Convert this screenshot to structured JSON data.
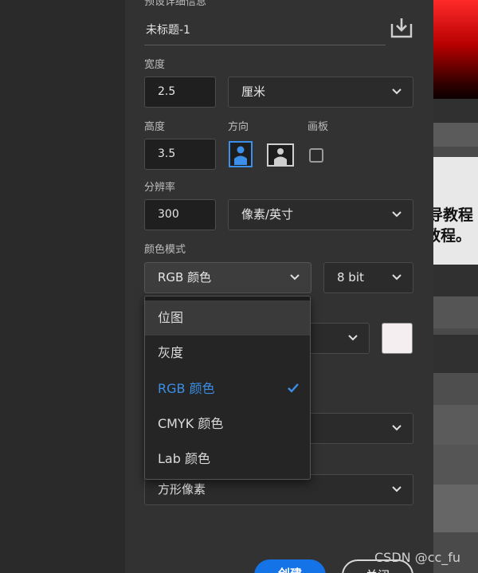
{
  "preset": {
    "title_partial": "预设详细信息",
    "doc_name": "未标题-1"
  },
  "width": {
    "label": "宽度",
    "value": "2.5",
    "unit": "厘米"
  },
  "height": {
    "label": "高度",
    "value": "3.5"
  },
  "orientation": {
    "label": "方向"
  },
  "artboard": {
    "label": "画板"
  },
  "resolution": {
    "label": "分辨率",
    "value": "300",
    "unit": "像素/英寸"
  },
  "color_mode": {
    "label": "颜色模式",
    "selected": "RGB 颜色",
    "bit_depth": "8 bit",
    "options": [
      "位图",
      "灰度",
      "RGB 颜色",
      "CMYK 颜色",
      "Lab 颜色"
    ]
  },
  "pixel_aspect": {
    "value": "方形像素"
  },
  "buttons": {
    "create": "创建",
    "close": "关闭"
  },
  "background_text": {
    "line1": "指导教程",
    "line2": "教程。"
  },
  "watermark": "CSDN @cc_fu",
  "colors": {
    "accent": "#1473e6",
    "selected_text": "#3b8fe8",
    "swatch": "#f5eef0"
  }
}
